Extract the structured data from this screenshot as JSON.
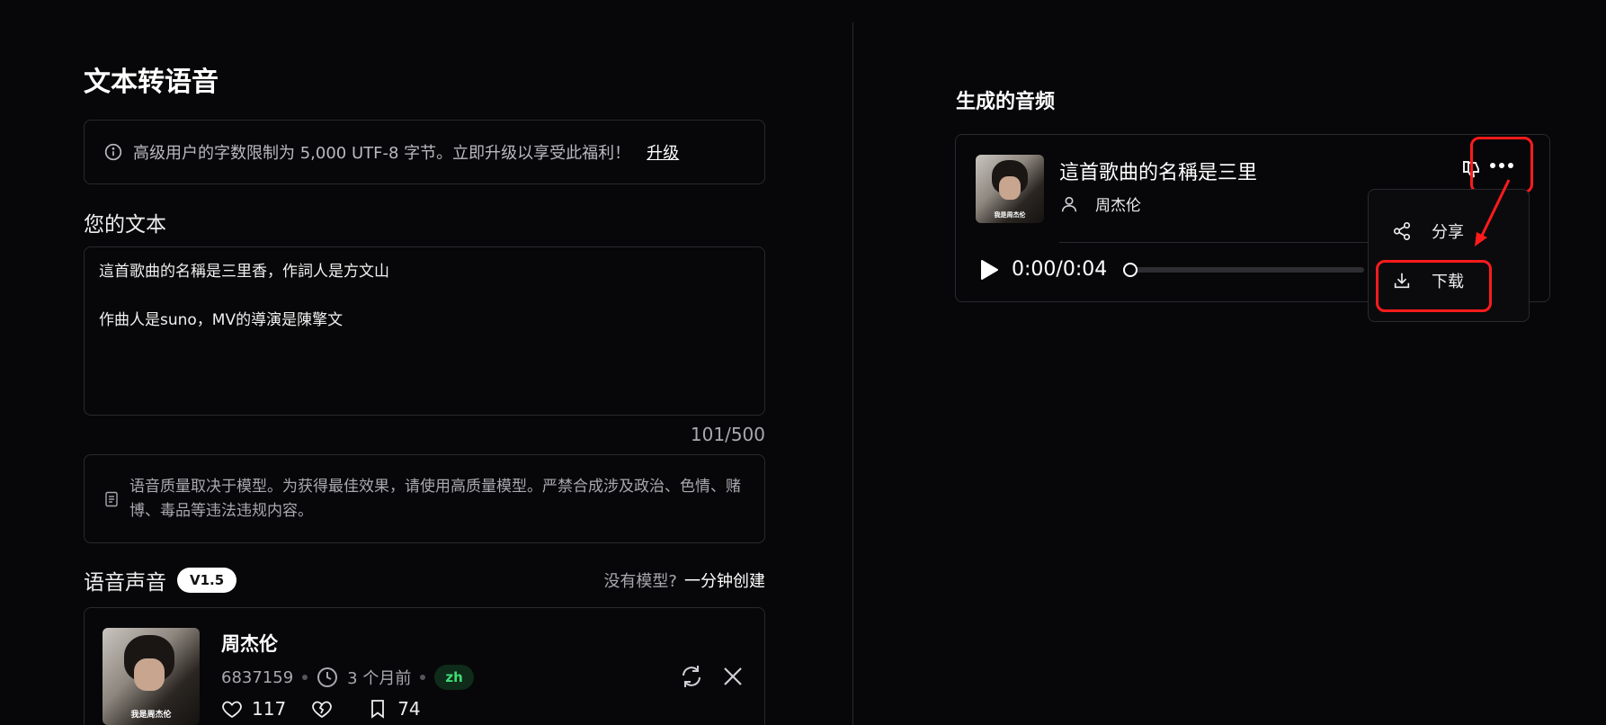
{
  "left": {
    "title": "文本转语音",
    "notice": {
      "text": "高级用户的字数限制为 5,000 UTF-8 字节。立即升级以享受此福利！",
      "upgrade_link": "升级"
    },
    "text_label": "您的文本",
    "text_value": "這首歌曲的名稱是三里香，作詞人是方文山\n\n作曲人是suno，MV的導演是陳擎文",
    "char_count": "101/500",
    "quality_note": "语音质量取决于模型。为获得最佳效果，请使用高质量模型。严禁合成涉及政治、色情、赌博、毒品等违法违规内容。",
    "voice_section": {
      "label": "语音声音",
      "version": "V1.5",
      "no_model_text": "没有模型?",
      "create_link": "一分钟创建"
    },
    "voice_card": {
      "thumbnail_caption": "我是周杰伦",
      "name": "周杰伦",
      "id": "6837159",
      "time": "3 个月前",
      "lang": "zh",
      "likes": "117",
      "saves": "74"
    }
  },
  "right": {
    "title": "生成的音频",
    "audio": {
      "thumbnail_caption": "我是周杰伦",
      "title": "這首歌曲的名稱是三里",
      "artist": "周杰伦",
      "time": "0:00/0:04",
      "progress": 0
    },
    "menu": {
      "share": "分享",
      "download": "下载"
    }
  },
  "colors": {
    "background": "#070709",
    "border": "#2a2a2e",
    "highlight": "#ff1b1b",
    "lang_badge": "#3ddc74"
  },
  "icons": [
    "info-icon",
    "document-icon",
    "clock-icon",
    "heart-icon",
    "broken-heart-icon",
    "bookmark-icon",
    "refresh-icon",
    "close-icon",
    "user-icon",
    "thumbs-down-icon",
    "more-icon",
    "play-icon",
    "share-icon",
    "download-icon"
  ]
}
